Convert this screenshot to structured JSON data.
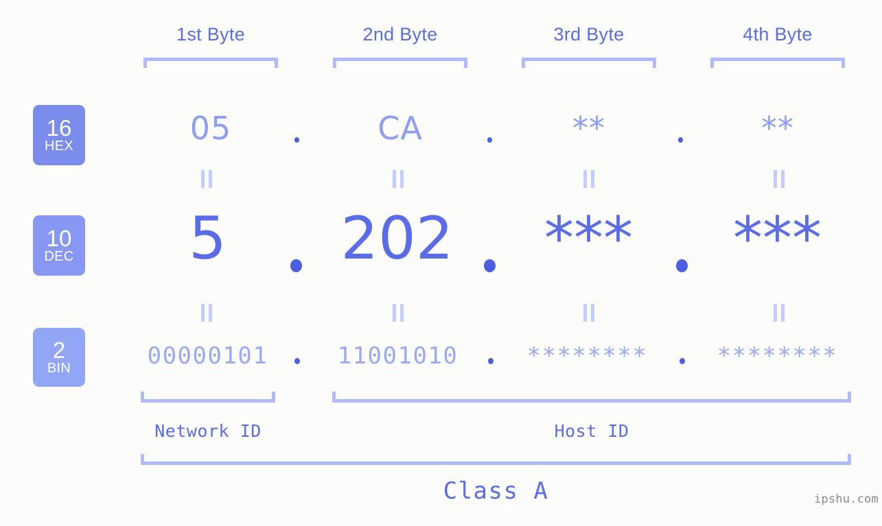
{
  "page": {
    "background": "#fcfdfa",
    "accent_strong": "#5a6ce8",
    "accent_mid": "#8d9cf4",
    "accent_light": "#afbaff",
    "dot_color": "#4a5fe3"
  },
  "byte_headers": [
    {
      "label": "1st Byte"
    },
    {
      "label": "2nd Byte"
    },
    {
      "label": "3rd Byte"
    },
    {
      "label": "4th Byte"
    }
  ],
  "rows": [
    {
      "badge": {
        "number": "16",
        "word": "HEX",
        "color": "#7b8ced"
      },
      "values": [
        "05",
        "CA",
        "**",
        "**"
      ],
      "separators": [
        ".",
        ".",
        "."
      ]
    },
    {
      "badge": {
        "number": "10",
        "word": "DEC",
        "color": "#8897f2"
      },
      "values": [
        "5",
        "202",
        "***",
        "***"
      ],
      "separators": [
        ".",
        ".",
        "."
      ]
    },
    {
      "badge": {
        "number": "2",
        "word": "BIN",
        "color": "#93a6f5"
      },
      "values": [
        "00000101",
        "11001010",
        "********",
        "********"
      ],
      "separators": [
        ".",
        ".",
        "."
      ]
    }
  ],
  "equals_marks": {
    "symbol": "||",
    "count_per_gap": 4,
    "gaps": 2
  },
  "segments": [
    {
      "label": "Network ID"
    },
    {
      "label": "Host ID"
    }
  ],
  "class": {
    "label": "Class A"
  },
  "watermark": {
    "text": "ipshu.com"
  }
}
